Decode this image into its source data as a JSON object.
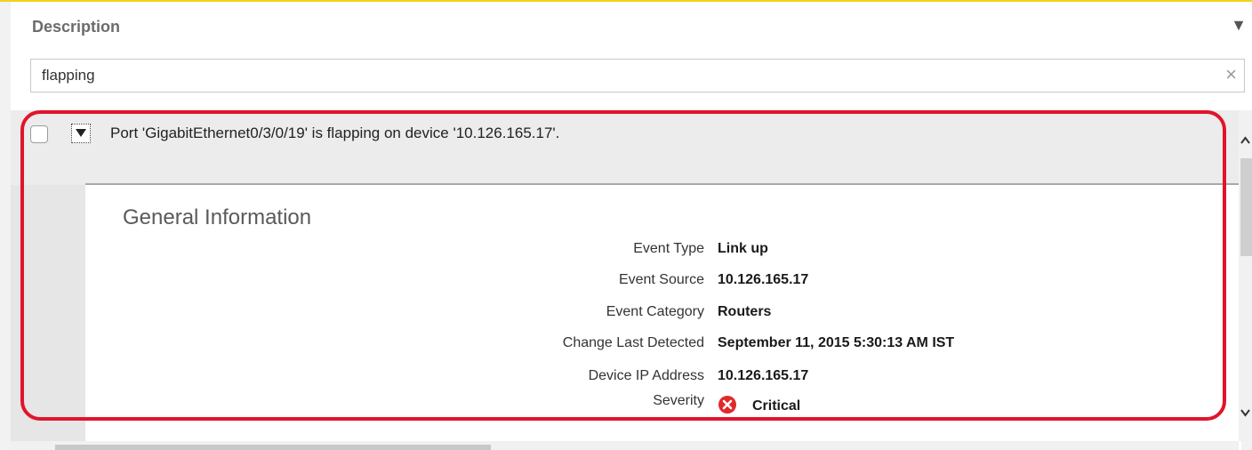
{
  "filter": {
    "title": "Description",
    "toggle_icon": "triangle-down-icon",
    "input_value": "flapping",
    "clear_icon": "close-icon"
  },
  "event_row": {
    "message": "Port 'GigabitEthernet0/3/0/19' is flapping on device '10.126.165.17'.",
    "checked": false,
    "expanded": true
  },
  "detail": {
    "section_title": "General Information",
    "fields": [
      {
        "label": "Event Type",
        "value": "Link up"
      },
      {
        "label": "Event Source",
        "value": "10.126.165.17"
      },
      {
        "label": "Event Category",
        "value": "Routers"
      },
      {
        "label": "Change Last Detected",
        "value": "September 11, 2015 5:30:13 AM IST"
      },
      {
        "label": "Device IP Address",
        "value": "10.126.165.17"
      }
    ],
    "severity": {
      "label": "Severity",
      "value": "Critical",
      "icon": "critical-x-icon",
      "color": "#e02a2a"
    }
  },
  "colors": {
    "accent": "#f2d21b",
    "highlight": "#e0152b"
  }
}
